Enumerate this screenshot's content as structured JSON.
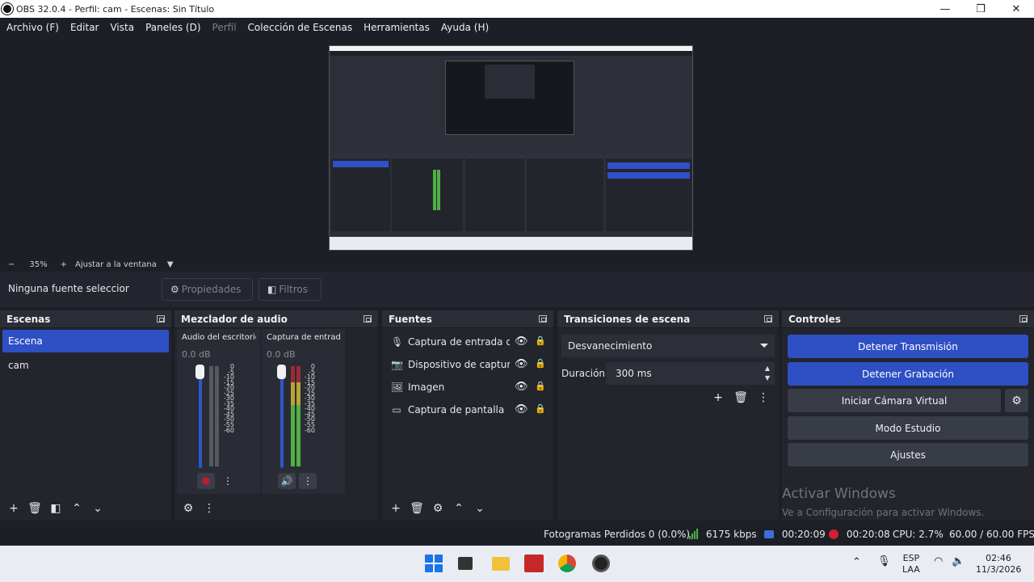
{
  "window": {
    "title": "OBS 32.0.4 - Perfil: cam - Escenas: Sin Título",
    "minimize": "—",
    "maximize": "❐",
    "close": "✕"
  },
  "menu": {
    "items": [
      "Archivo (F)",
      "Editar",
      "Vista",
      "Paneles (D)",
      "Perfil",
      "Colección de Escenas",
      "Herramientas",
      "Ayuda (H)"
    ]
  },
  "zoom": {
    "minus": "−",
    "level": "35%",
    "plus": "+",
    "fit": "Ajustar a la ventana",
    "caret": "▼"
  },
  "context": {
    "source": "Ninguna fuente seleccionada",
    "properties": "Propiedades",
    "filters": "Filtros"
  },
  "scenes": {
    "title": "Escenas",
    "items": [
      "Escena",
      "cam"
    ],
    "active_index": 0
  },
  "mixer": {
    "title": "Mezclador de audio",
    "channels": [
      {
        "name": "Audio del escritorio",
        "db": "0.0 dB",
        "level": 0.0
      },
      {
        "name": "Captura de entrada de audio",
        "db": "0.0 dB",
        "level": 0.88
      }
    ],
    "scale": [
      "0",
      "-5",
      "-10",
      "-15",
      "-20",
      "-25",
      "-30",
      "-35",
      "-40",
      "-45",
      "-50",
      "-55",
      "-60"
    ]
  },
  "sources": {
    "title": "Fuentes",
    "items": [
      {
        "label": "Captura de entrada de audio",
        "icon": "microphone-icon"
      },
      {
        "label": "Dispositivo de captura de video",
        "icon": "camera-icon"
      },
      {
        "label": "Imagen",
        "icon": "image-icon"
      },
      {
        "label": "Captura de pantalla",
        "icon": "monitor-icon"
      }
    ]
  },
  "transitions": {
    "title": "Transiciones de escena",
    "selected": "Desvanecimiento",
    "duration_label": "Duración",
    "duration_value": "300 ms"
  },
  "controls": {
    "title": "Controles",
    "stop_stream": "Detener Transmisión",
    "stop_record": "Detener Grabación",
    "virtual_cam": "Iniciar Cámara Virtual",
    "studio_mode": "Modo Estudio",
    "settings": "Ajustes",
    "watermark_title": "Activar Windows",
    "watermark_sub": "Ve a Configuración para activar Windows."
  },
  "status": {
    "dropped": "Fotogramas Perdidos 0 (0.0%)",
    "bitrate": "6175 kbps",
    "stream_time": "00:20:09",
    "rec_time": "00:20:08",
    "cpu": "CPU: 2.7%",
    "fps": "60.00 / 60.00 FPS"
  },
  "taskbar": {
    "lang": "ESP",
    "layout": "LAA",
    "time": "02:46",
    "date": "11/3/2026"
  },
  "colors": {
    "accent": "#2f4fc4",
    "panel": "#22252c",
    "background": "#1d1f26",
    "meter_green": "#4fb044",
    "record_red": "#d2202e"
  }
}
